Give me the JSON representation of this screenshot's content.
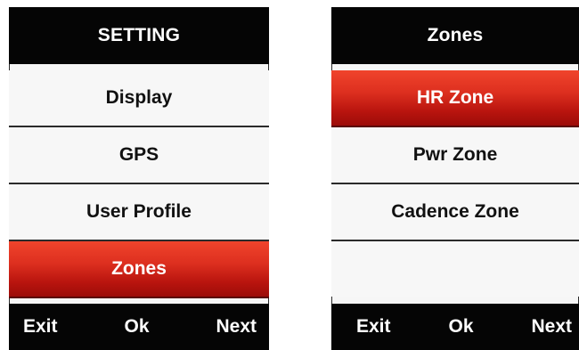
{
  "left_screen": {
    "title": "SETTING",
    "items": [
      {
        "label": "Display",
        "selected": false
      },
      {
        "label": "GPS",
        "selected": false
      },
      {
        "label": "User Profile",
        "selected": false
      },
      {
        "label": "Zones",
        "selected": true
      }
    ],
    "softkeys": {
      "exit": "Exit",
      "ok": "Ok",
      "next": "Next"
    }
  },
  "right_screen": {
    "title": "Zones",
    "items": [
      {
        "label": "HR Zone",
        "selected": true
      },
      {
        "label": "Pwr Zone",
        "selected": false
      },
      {
        "label": "Cadence Zone",
        "selected": false
      }
    ],
    "softkeys": {
      "exit": "Exit",
      "ok": "Ok",
      "next": "Next"
    }
  },
  "colors": {
    "bar_background": "#050505",
    "selected_gradient_top": "#f0442c",
    "selected_gradient_bottom": "#9c0c09",
    "list_background": "#f7f7f7"
  }
}
